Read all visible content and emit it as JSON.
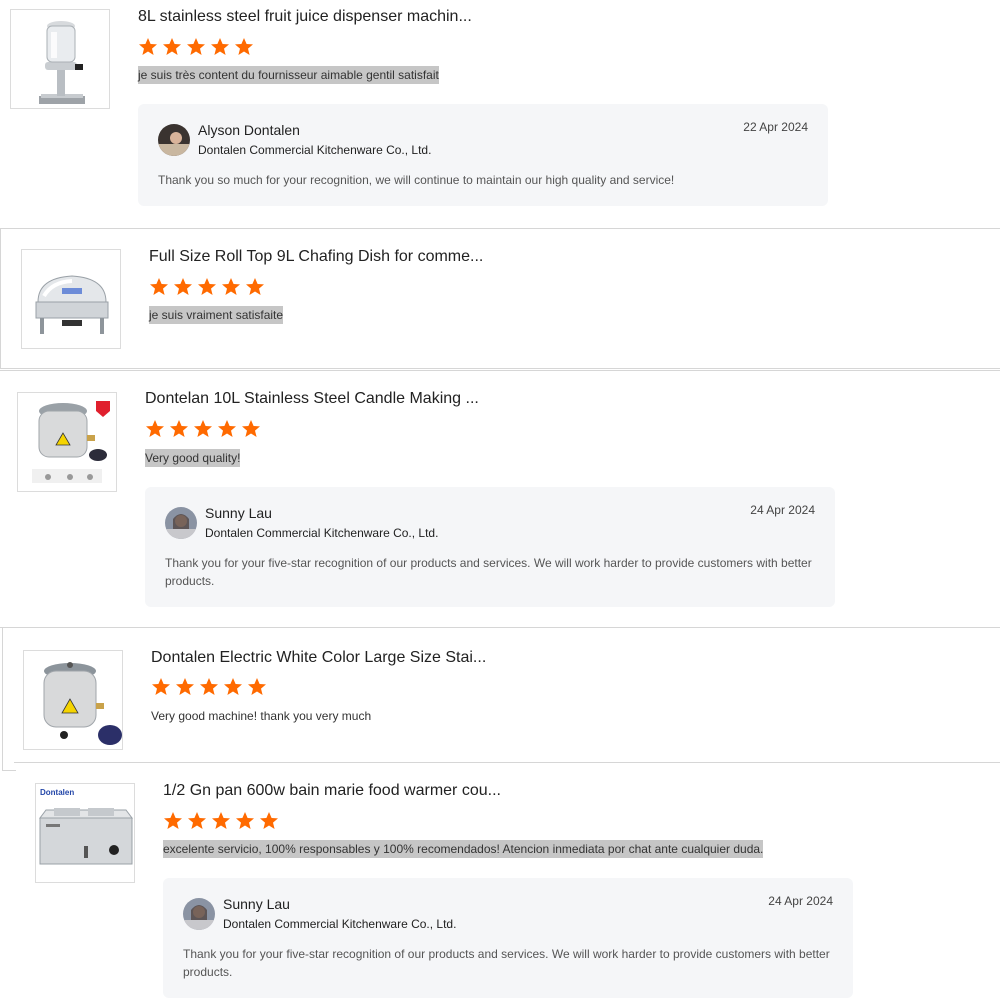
{
  "accent": "#ff6a00",
  "reviews": [
    {
      "title": "8L stainless steel fruit juice dispenser machin...",
      "rating": 5,
      "comment": "je suis très content du fournisseur aimable gentil satisfait",
      "reply": {
        "name": "Alyson Dontalen",
        "company": "Dontalen Commercial Kitchenware Co., Ltd.",
        "date": "22 Apr 2024",
        "text": "Thank you so much for your recognition, we will continue to maintain our high quality and service!"
      }
    },
    {
      "title": "Full Size Roll Top 9L Chafing Dish for comme...",
      "rating": 5,
      "comment": "je suis vraiment satisfaite"
    },
    {
      "title": "Dontelan 10L Stainless Steel Candle Making ...",
      "rating": 5,
      "comment": "Very good quality!",
      "reply": {
        "name": "Sunny Lau",
        "company": "Dontalen Commercial Kitchenware Co., Ltd.",
        "date": "24 Apr 2024",
        "text": "Thank you for your five-star recognition of our products and services. We will work harder to provide customers with better products."
      }
    },
    {
      "title": "Dontalen Electric White Color Large Size Stai...",
      "rating": 5,
      "comment": "Very good machine! thank you very much"
    },
    {
      "title": "1/2 Gn pan 600w bain marie food warmer cou...",
      "rating": 5,
      "comment": "excelente servicio, 100% responsables y 100% recomendados! Atencion inmediata por chat ante cualquier duda.",
      "brand_label": "Dontalen",
      "reply": {
        "name": "Sunny Lau",
        "company": "Dontalen Commercial Kitchenware Co., Ltd.",
        "date": "24 Apr 2024",
        "text": "Thank you for your five-star recognition of our products and services. We will work harder to provide customers with better products."
      }
    }
  ]
}
